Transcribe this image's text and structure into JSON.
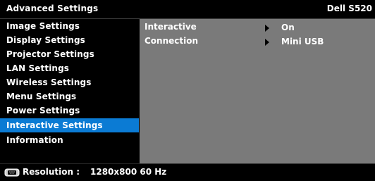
{
  "header": {
    "title": "Advanced Settings",
    "model": "Dell S520"
  },
  "sidebar": {
    "items": [
      {
        "label": "Image Settings",
        "active": false
      },
      {
        "label": "Display Settings",
        "active": false
      },
      {
        "label": "Projector Settings",
        "active": false
      },
      {
        "label": "LAN Settings",
        "active": false
      },
      {
        "label": "Wireless Settings",
        "active": false
      },
      {
        "label": "Menu Settings",
        "active": false
      },
      {
        "label": "Power Settings",
        "active": false
      },
      {
        "label": "Interactive Settings",
        "active": true
      },
      {
        "label": "Information",
        "active": false
      }
    ]
  },
  "content": {
    "rows": [
      {
        "label": "Interactive",
        "value": "On",
        "icon": "triangle-right-icon"
      },
      {
        "label": "Connection",
        "value": "Mini USB",
        "icon": "triangle-right-icon"
      }
    ]
  },
  "footer": {
    "icon": "monitor-icon",
    "label": "Resolution :",
    "value": "1280x800 60 Hz"
  },
  "colors": {
    "highlight": "#0b7bd4",
    "panel": "#7a7a7a",
    "background": "#000000",
    "text": "#ffffff"
  }
}
